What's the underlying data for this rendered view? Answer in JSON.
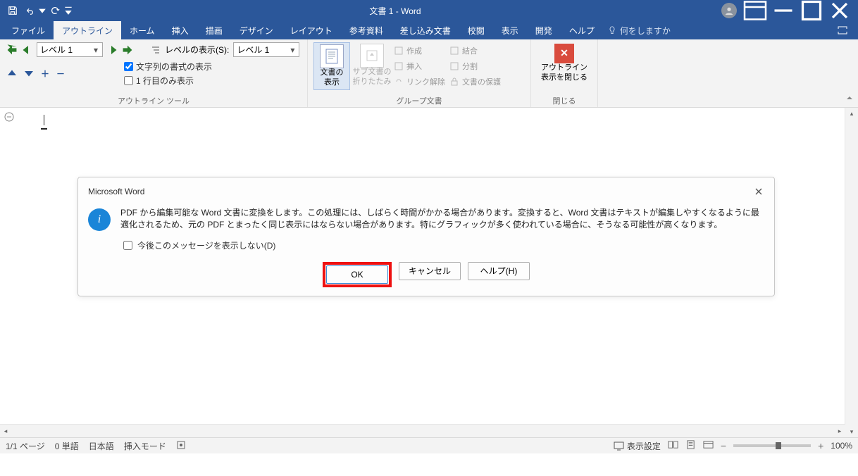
{
  "titlebar": {
    "title": "文書 1  -  Word"
  },
  "tabs": {
    "file": "ファイル",
    "outline": "アウトライン",
    "home": "ホーム",
    "insert": "挿入",
    "draw": "描画",
    "design": "デザイン",
    "layout": "レイアウト",
    "references": "参考資料",
    "mailings": "差し込み文書",
    "review": "校閲",
    "view": "表示",
    "developer": "開発",
    "help": "ヘルプ",
    "tell": "何をしますか"
  },
  "ribbon": {
    "level_value": "レベル 1",
    "show_level_label": "レベルの表示(S):",
    "show_level_value": "レベル 1",
    "show_formatting": "文字列の書式の表示",
    "first_line_only": "1 行目のみ表示",
    "group_outline": "アウトライン ツール",
    "show_doc": "文書の\n表示",
    "fold_sub": "サブ文書の\n折りたたみ",
    "create": "作成",
    "insert2": "挿入",
    "unlink": "リンク解除",
    "merge": "結合",
    "split": "分割",
    "protect": "文書の保護",
    "group_master": "グループ文書",
    "close_outline": "アウトライン\n表示を閉じる",
    "group_close": "閉じる"
  },
  "dialog": {
    "title": "Microsoft Word",
    "msg": "PDF から編集可能な Word 文書に変換をします。この処理には、しばらく時間がかかる場合があります。変換すると、Word 文書はテキストが編集しやすくなるように最適化されるため、元の PDF とまったく同じ表示にはならない場合があります。特にグラフィックが多く使われている場合に、そうなる可能性が高くなります。",
    "dont_show": "今後このメッセージを表示しない(D)",
    "ok": "OK",
    "cancel": "キャンセル",
    "help": "ヘルプ(H)"
  },
  "status": {
    "page": "1/1 ページ",
    "words": "0 単語",
    "lang": "日本語",
    "mode": "挿入モード",
    "display": "表示設定",
    "zoom": "100%"
  }
}
